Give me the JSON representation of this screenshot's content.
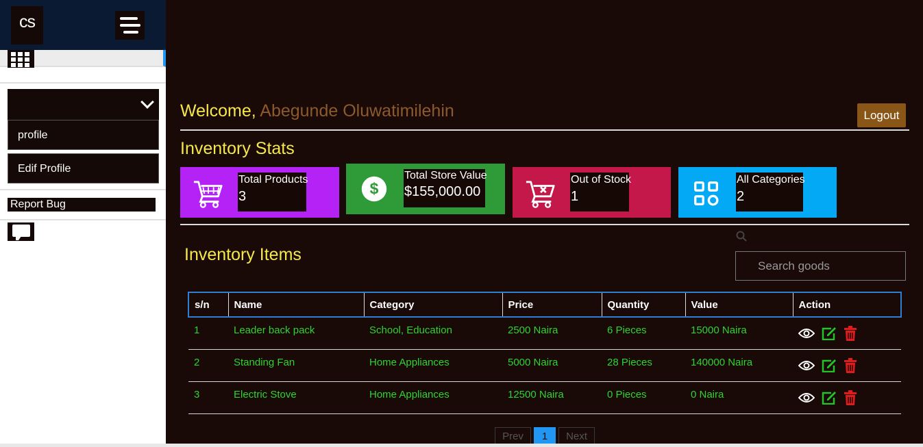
{
  "sidebar": {
    "logo_text": "cs",
    "menu": {
      "items": [
        {
          "label": "profile"
        },
        {
          "label": "Edif Profile"
        }
      ]
    },
    "report_bug_label": "Report Bug"
  },
  "header": {
    "welcome_label": "Welcome,",
    "user_name": "Abegunde Oluwatimilehin",
    "logout_label": "Logout"
  },
  "stats": {
    "title": "Inventory Stats",
    "cards": [
      {
        "label": "Total Products",
        "value": "3",
        "color": "#b522f5",
        "icon": "cart-icon"
      },
      {
        "label": "Total Store Value",
        "value": "$155,000.00",
        "color": "#2e9a38",
        "icon": "dollar-icon"
      },
      {
        "label": "Out of Stock",
        "value": "1",
        "color": "#c4174a",
        "icon": "cart-x-icon"
      },
      {
        "label": "All Categories",
        "value": "2",
        "color": "#03a9f4",
        "icon": "categories-icon"
      }
    ]
  },
  "inventory": {
    "title": "Inventory Items",
    "search_placeholder": "Search goods",
    "columns": [
      "s/n",
      "Name",
      "Category",
      "Price",
      "Quantity",
      "Value",
      "Action"
    ],
    "rows": [
      {
        "sn": "1",
        "name": "Leader back pack",
        "category": "School, Education",
        "price": "2500 Naira",
        "quantity": "6 Pieces",
        "value": "15000 Naira"
      },
      {
        "sn": "2",
        "name": "Standing Fan",
        "category": "Home Appliances",
        "price": "5000 Naira",
        "quantity": "28 Pieces",
        "value": "140000 Naira"
      },
      {
        "sn": "3",
        "name": "Electric Stove",
        "category": "Home Appliances",
        "price": "12500 Naira",
        "quantity": "0 Pieces",
        "value": "0 Naira"
      }
    ]
  },
  "pagination": {
    "prev_label": "Prev",
    "current_page": "1",
    "next_label": "Next"
  },
  "colors": {
    "accent_yellow": "#f4e84a",
    "row_text_green": "#2fd42f",
    "logout_bg": "#8a5618",
    "page_active": "#2196f3"
  }
}
